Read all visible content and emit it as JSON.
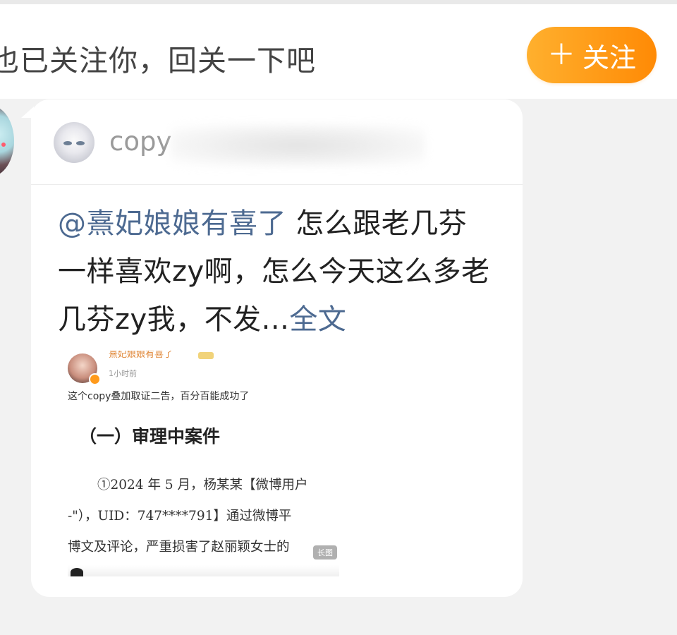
{
  "follow_bar": {
    "text": "也已关注你，回关一下吧",
    "button_plus": "＋",
    "button_label": "关注"
  },
  "post": {
    "author_name": "copy",
    "mention": "@熹妃娘娘有喜了",
    "body": " 怎么跟老几芬一样喜欢zy啊，怎么今天这么多老几芬zy我，不发...",
    "full_text_link": "全文"
  },
  "embedded_image": {
    "name": "熹妃娘娘有喜了",
    "time": "1小时前",
    "caption": "这个copy叠加取证二告，百分百能成功了",
    "heading": "（一）审理中案件",
    "line1": "①2024 年 5 月，杨某某【微博用户",
    "line2": "-\"），UID：747****791】通过微博平",
    "line3": "博文及评论，严重损害了赵丽颖女士的",
    "tag": "长图"
  },
  "colors": {
    "accent_orange": "#ff8a05",
    "link_blue": "#4d6a91",
    "background": "#f2f2f2"
  }
}
